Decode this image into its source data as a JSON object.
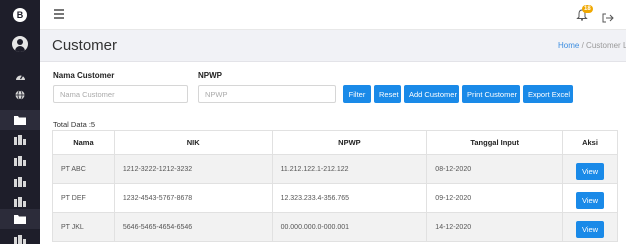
{
  "header": {
    "page_title": "Customer",
    "breadcrumb_home": "Home",
    "breadcrumb_separator": "/",
    "breadcrumb_current": "Customer Li",
    "notification_count": "18"
  },
  "filters": {
    "nama_label": "Nama Customer",
    "nama_placeholder": "Nama Customer",
    "npwp_label": "NPWP",
    "npwp_placeholder": "NPWP"
  },
  "buttons": {
    "filter": "Filter",
    "reset": "Reset",
    "add": "Add Customer",
    "print": "Print Customer",
    "export": "Export Excel"
  },
  "table": {
    "total_label": "Total Data :5",
    "headers": [
      "Nama",
      "NIK",
      "NPWP",
      "Tanggal Input",
      "Aksi"
    ],
    "rows": [
      {
        "nama": "PT ABC",
        "nik": "1212-3222-1212-3232",
        "npwp": "11.212.122.1-212.122",
        "tanggal": "08-12-2020",
        "aksi": "View"
      },
      {
        "nama": "PT DEF",
        "nik": "1232-4543-5767-8678",
        "npwp": "12.323.233.4-356.765",
        "tanggal": "09-12-2020",
        "aksi": "View"
      },
      {
        "nama": "PT JKL",
        "nik": "5646-5465-4654-6546",
        "npwp": "00.000.000.0-000.001",
        "tanggal": "14-12-2020",
        "aksi": "View"
      }
    ]
  },
  "colors": {
    "accent": "#1a8ae8",
    "sidebar": "#1e1e2a",
    "header_bg": "#f1f2f6",
    "badge": "#f0a800"
  },
  "icons": {
    "sidebar": [
      "logo-icon",
      "avatar",
      "dashboard-icon",
      "globe-icon",
      "folder-icon",
      "building-icon",
      "building-icon",
      "building-icon",
      "building-icon",
      "folder-icon",
      "building-icon"
    ],
    "topbar": [
      "hamburger-icon",
      "bell-icon",
      "logout-icon"
    ]
  }
}
